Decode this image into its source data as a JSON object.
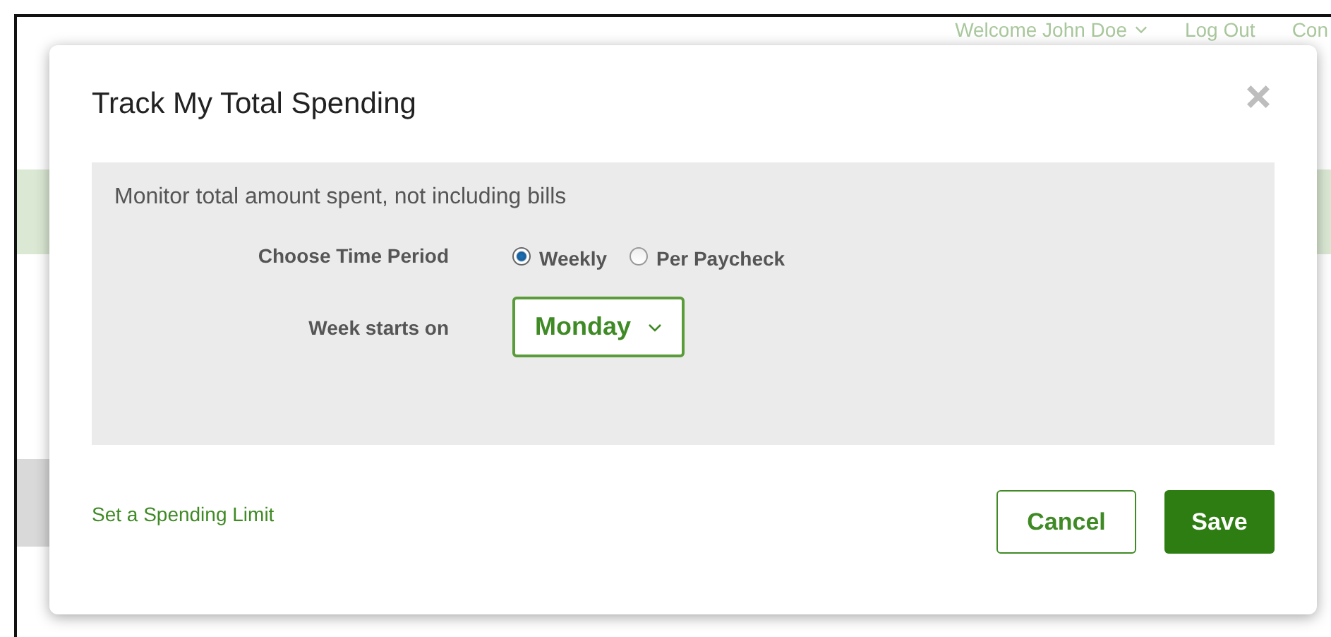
{
  "background_page": {
    "header_links": [
      {
        "label": "Welcome John Doe",
        "kind": "menu"
      },
      {
        "label": "Log Out",
        "kind": "link"
      },
      {
        "label": "Con",
        "kind": "link"
      }
    ]
  },
  "dialog": {
    "title": "Track My Total Spending",
    "description": "Monitor total amount spent, not including bills",
    "fields": [
      {
        "label": "Choose Time Period",
        "kind": "radio",
        "options": [
          {
            "label": "Weekly",
            "selected": true
          },
          {
            "label": "Per Paycheck",
            "selected": false
          }
        ]
      },
      {
        "label": "Week starts on",
        "kind": "select",
        "value": "Monday"
      }
    ],
    "link": "Set a Spending Limit",
    "buttons": [
      {
        "label": "Cancel",
        "kind": "secondary"
      },
      {
        "label": "Save",
        "kind": "primary"
      }
    ]
  }
}
